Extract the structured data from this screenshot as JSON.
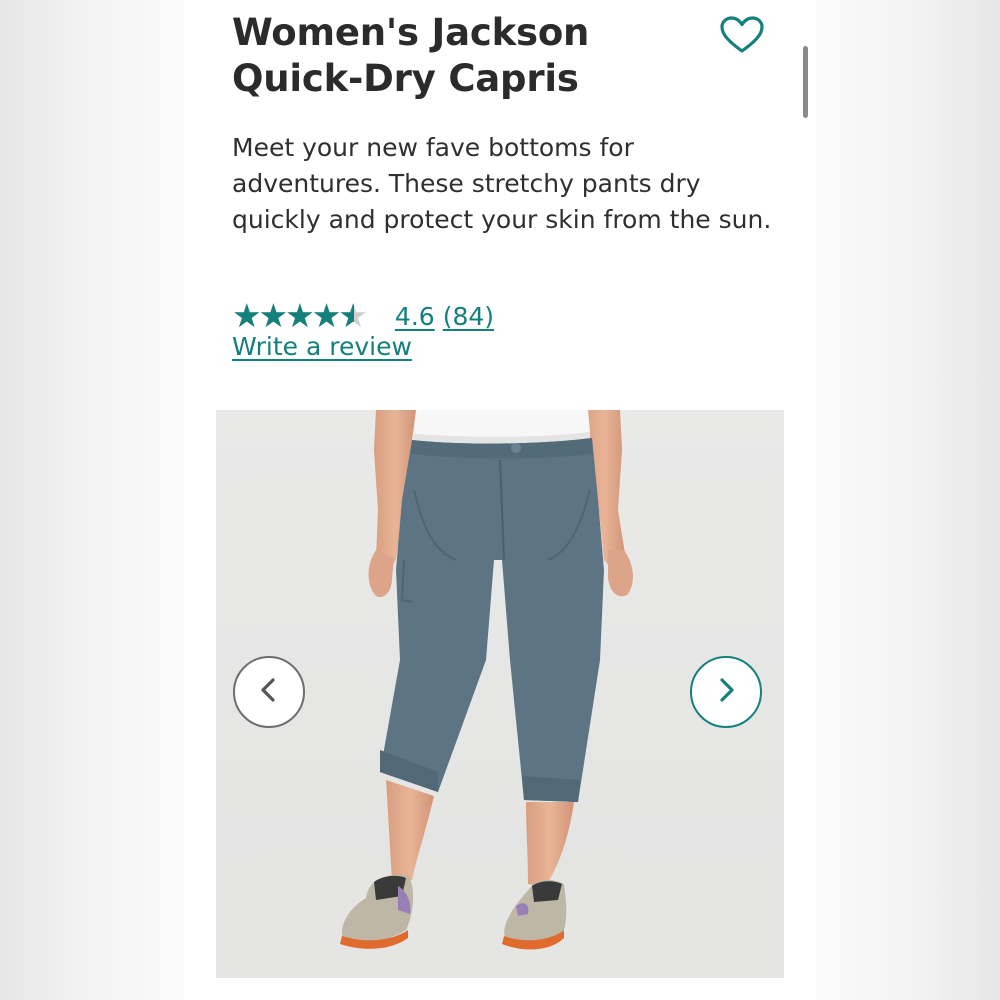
{
  "product": {
    "title": "Women's Jackson Quick-Dry Capris",
    "description": "Meet your new fave bottoms for adventures. These stretchy pants dry quickly and protect your skin from the sun.",
    "rating": {
      "value": 4.6,
      "max": 5,
      "value_label": "4.6",
      "count_label": "(84)",
      "write_review_label": "Write a review"
    },
    "favorite_icon": "heart-outline-icon"
  },
  "gallery": {
    "image_description": "capri-pants-product-photo",
    "prev_icon": "chevron-left-icon",
    "next_icon": "chevron-right-icon"
  },
  "colors": {
    "accent": "#14807c",
    "title": "#2b2b2b",
    "body_text": "#2f2f2f",
    "pants": "#5c7483",
    "gallery_bg": "#e8e8e7"
  }
}
